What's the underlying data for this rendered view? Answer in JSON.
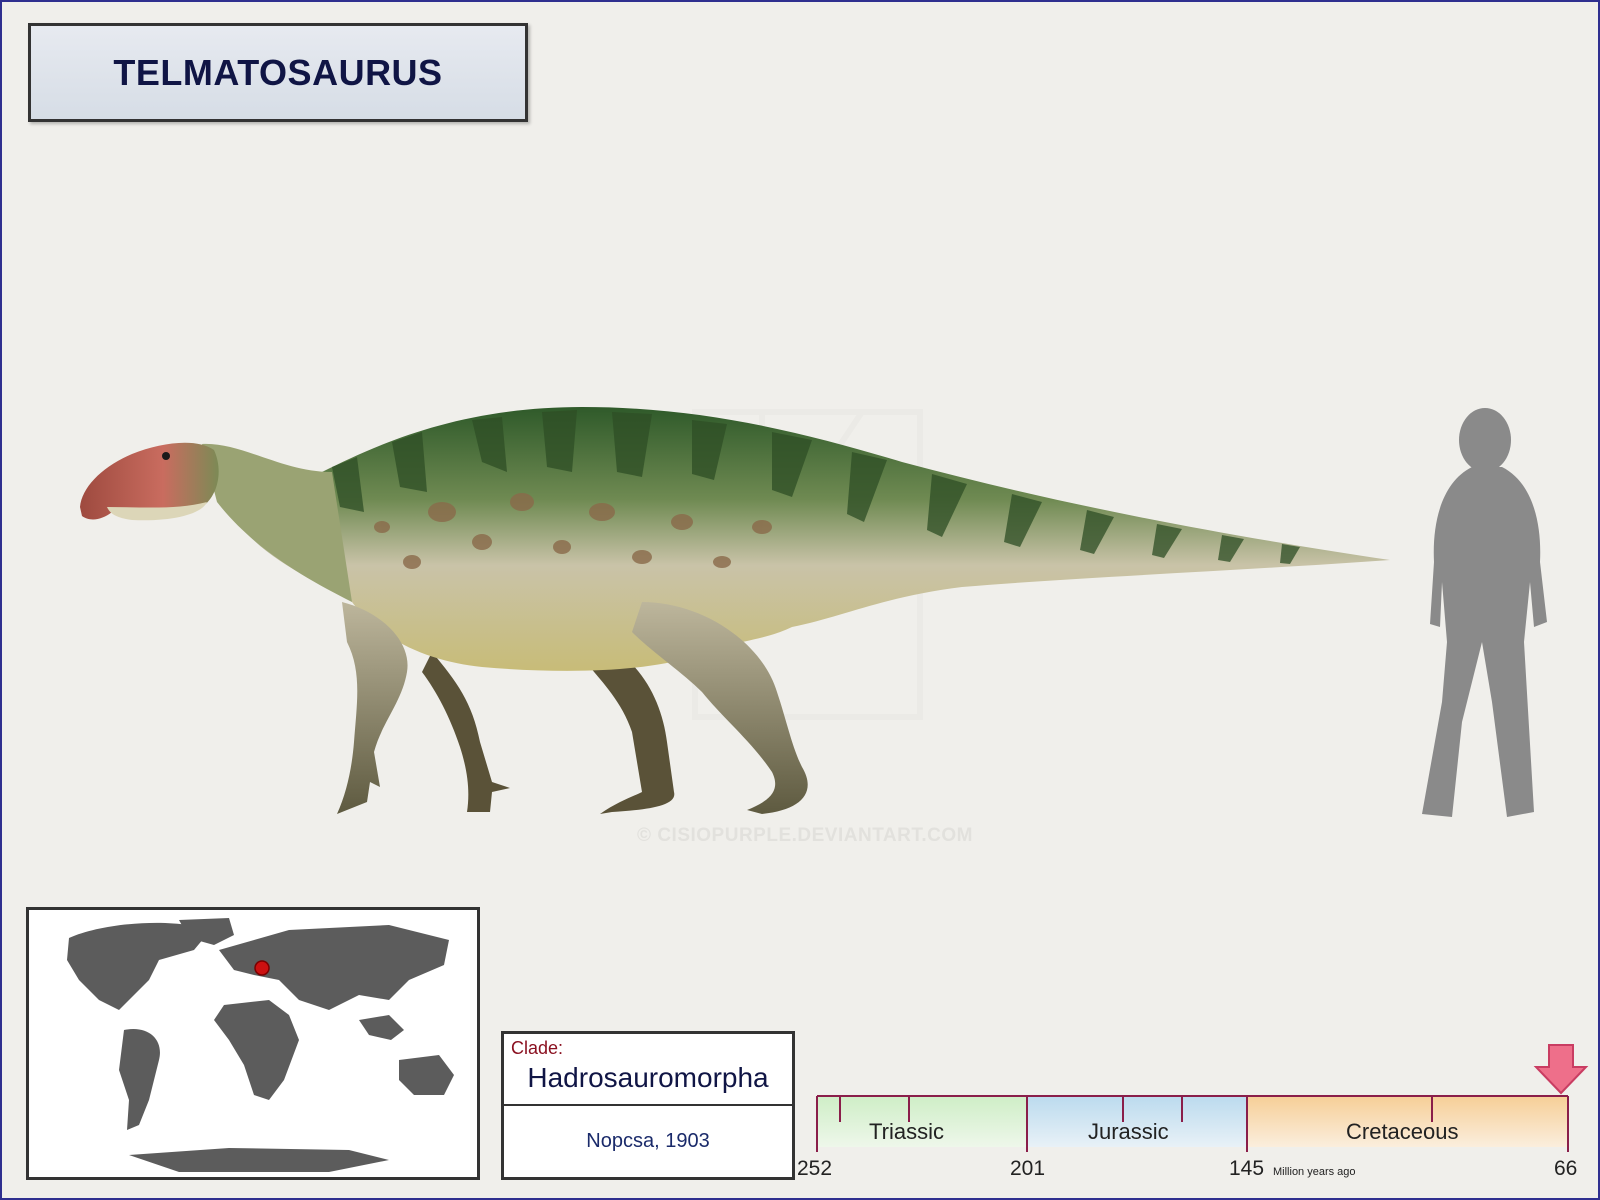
{
  "title": "TELMATOSAURUS",
  "watermark": "© CISIOPURPLE.DEVIANTART.COM",
  "clade": {
    "label": "Clade:",
    "name": "Hadrosauromorpha",
    "author": "Nopcsa, 1903"
  },
  "timeline": {
    "periods": [
      "Triassic",
      "Jurassic",
      "Cretaceous"
    ],
    "ticks": [
      "252",
      "201",
      "145",
      "66"
    ],
    "unit": "Million years ago",
    "colors": {
      "triassic": "#cfeec7",
      "jurassic": "#bcdbee",
      "cretaceous": "#f6cf98",
      "axis": "#8a1e4a",
      "marker": "#ee6f8a"
    }
  },
  "icons": {
    "map": "world-map-icon",
    "location": "location-dot-icon",
    "human": "human-silhouette-icon",
    "arrow": "arrow-down-icon"
  },
  "colors": {
    "title_text": "#101545",
    "frame": "#2f2f8f",
    "map_land": "#5c5c5c",
    "location_dot": "#cc1111"
  }
}
